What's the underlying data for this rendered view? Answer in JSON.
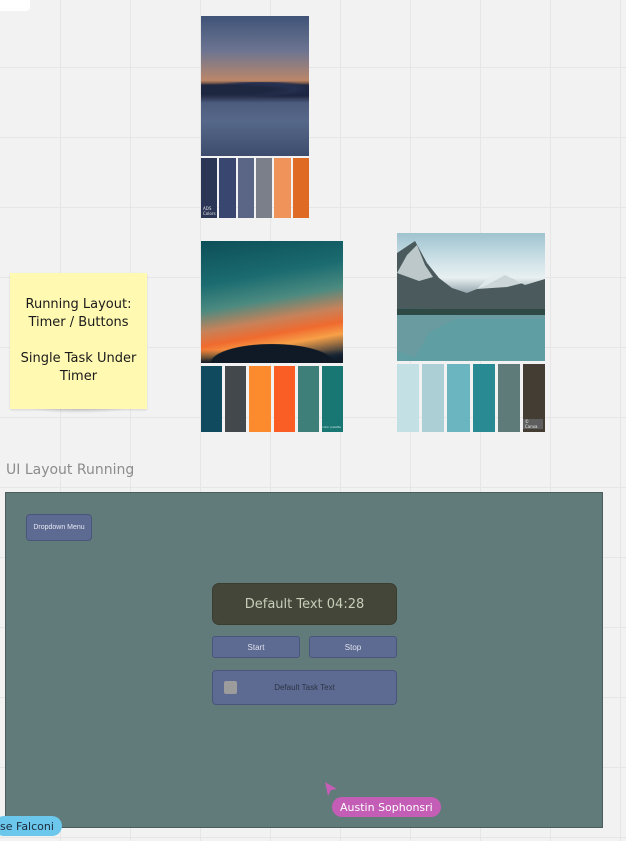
{
  "sticky_note": {
    "line1": "Running Layout:",
    "line2": "Timer / Buttons",
    "line3": "Single Task Under",
    "line4": "Timer",
    "color": "#fff9b2"
  },
  "moodboard_sunset": {
    "swatch_label_line1": "ADS",
    "swatch_label_line2": "Colors",
    "colors": [
      "#2b3656",
      "#394770",
      "#5b6585",
      "#7a7f8a",
      "#f0935a",
      "#de6a24"
    ]
  },
  "moodboard_teal_sky": {
    "swatch_tag": "color palette",
    "colors": [
      "#0f4a5e",
      "#42484c",
      "#fb8b2d",
      "#fb5e24",
      "#3e7f79",
      "#187772"
    ]
  },
  "moodboard_mountains": {
    "swatch_badge": "© Canva",
    "colors": [
      "#c3e0e5",
      "#abcfd5",
      "#6bb5c0",
      "#2a8a93",
      "#5e7a79",
      "#433d33"
    ]
  },
  "frame": {
    "title": "UI Layout Running",
    "background": "#617b7a",
    "dropdown_label": "Dropdown Menu",
    "timer_text": "Default Text 04:28",
    "start_label": "Start",
    "stop_label": "Stop",
    "task_text": "Default Task Text"
  },
  "cursors": [
    {
      "name": "Austin Sophonsri",
      "color": "#c45db6"
    },
    {
      "name": "se Falconi",
      "color": "#6cc7ec"
    }
  ]
}
